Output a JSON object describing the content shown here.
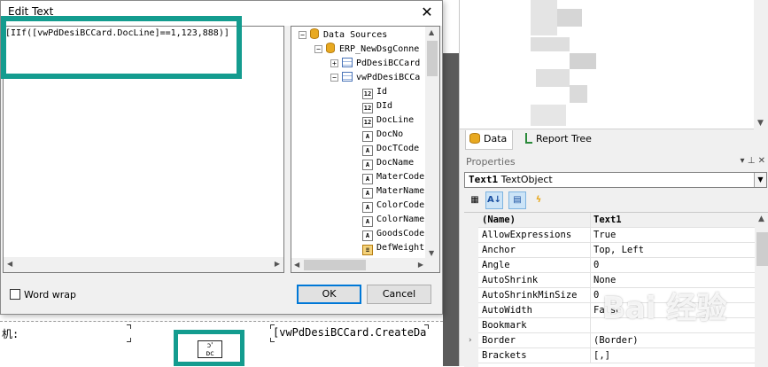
{
  "dialog": {
    "title": "Edit Text",
    "close_glyph": "✕",
    "expression": "[IIf([vwPdDesiBCCard.DocLine]==1,123,888)]",
    "word_wrap_label": "Word wrap",
    "ok_label": "OK",
    "cancel_label": "Cancel"
  },
  "tree": {
    "root": "Data Sources",
    "connection": "ERP_NewDsgConne",
    "table1": "PdDesiBCCard",
    "table2": "vwPdDesiBCCa",
    "fields": [
      {
        "label": "Id",
        "icon": "12"
      },
      {
        "label": "DId",
        "icon": "12"
      },
      {
        "label": "DocLine",
        "icon": "12"
      },
      {
        "label": "DocNo",
        "icon": "A"
      },
      {
        "label": "DocTCode",
        "icon": "A"
      },
      {
        "label": "DocName",
        "icon": "A"
      },
      {
        "label": "MaterCode",
        "icon": "A"
      },
      {
        "label": "MaterName",
        "icon": "A"
      },
      {
        "label": "ColorCode",
        "icon": "A"
      },
      {
        "label": "ColorName",
        "icon": "A"
      },
      {
        "label": "GoodsCode",
        "icon": "A"
      },
      {
        "label": "DefWeight",
        "icon": "≡"
      }
    ]
  },
  "designer": {
    "label_fragment": "机:",
    "field_text": "[vwPdDesiBCCard.CreateDa",
    "qr_text": "ↄ'\nᴅᴄ"
  },
  "right_panel": {
    "tabs": [
      "Data",
      "Report Tree"
    ],
    "properties_title": "Properties",
    "pin_glyphs": "▾ ⊥ ✕",
    "object_name": "Text1",
    "object_type": "TextObject",
    "toolbar_icons": [
      "categorized-icon",
      "sort-az-icon",
      "properties-icon",
      "events-icon"
    ],
    "rows": [
      {
        "name": "(Name)",
        "value": "Text1"
      },
      {
        "name": "AllowExpressions",
        "value": "True"
      },
      {
        "name": "Anchor",
        "value": "Top, Left"
      },
      {
        "name": "Angle",
        "value": "0"
      },
      {
        "name": "AutoShrink",
        "value": "None"
      },
      {
        "name": "AutoShrinkMinSize",
        "value": "0"
      },
      {
        "name": "AutoWidth",
        "value": "False"
      },
      {
        "name": "Bookmark",
        "value": ""
      },
      {
        "name": "Border",
        "value": "(Border)"
      },
      {
        "name": "Brackets",
        "value": "[,]"
      }
    ],
    "watermark": "Bai 经验"
  },
  "colors": {
    "highlight": "#149c8f",
    "accent": "#0078d7"
  }
}
